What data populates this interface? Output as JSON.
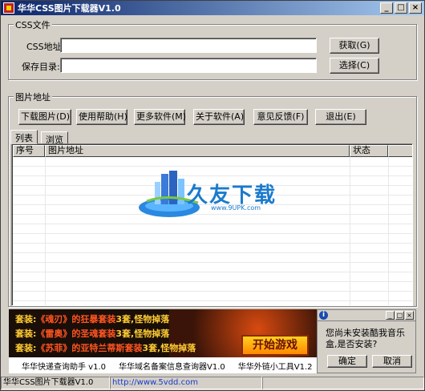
{
  "window": {
    "title": "华华CSS图片下载器V1.0",
    "minimize": "_",
    "maximize": "□",
    "close": "×"
  },
  "css_group": {
    "title": "CSS文件",
    "css_address_label": "CSS地址:",
    "css_address_value": "",
    "save_dir_label": "保存目录:",
    "save_dir_value": "",
    "fetch_button": "获取(G)",
    "choose_button": "选择(C)"
  },
  "image_group": {
    "title": "图片地址",
    "buttons": [
      "下载图片(D)",
      "使用帮助(H)",
      "更多软件(M)",
      "关于软件(A)",
      "意见反馈(F)",
      "退出(E)"
    ]
  },
  "tabs": [
    "列表",
    "浏览"
  ],
  "list": {
    "columns": [
      "序号",
      "图片地址",
      "状态"
    ],
    "rows": []
  },
  "watermark": {
    "text": "久友下载",
    "url": "www.9UPK.com"
  },
  "ad": {
    "lines": [
      {
        "prefix": "套装:",
        "hl": "《魂刃》的狂暴套装",
        "suffix": "3套,怪物掉落"
      },
      {
        "prefix": "套装:",
        "hl": "《雷奥》的圣魂套装",
        "suffix": "3套,怪物掉落"
      },
      {
        "prefix": "套装:",
        "hl": "《苏菲》的亚特兰蒂斯套装",
        "suffix": "3套,怪物掉落"
      }
    ],
    "play_button": "开始游戏",
    "links": [
      "华华快递查询助手 v1.0",
      "华华域名备案信息查询器V1.0",
      "华华外链小工具V1.2"
    ]
  },
  "popup": {
    "info": "i",
    "message": "您尚未安装酷我音乐盒,是否安装?",
    "confirm": "确定",
    "cancel": "取消"
  },
  "status": {
    "app": "华华CSS图片下载器V1.0",
    "url": "http://www.5vdd.com"
  }
}
